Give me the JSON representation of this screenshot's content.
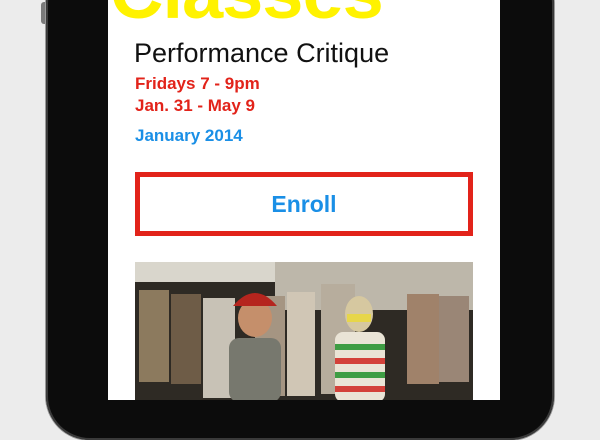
{
  "header": {
    "title": "Classes"
  },
  "class": {
    "name": "Performance Critique",
    "time": "Fridays 7 - 9pm",
    "dates": "Jan. 31 - May 9",
    "term": "January 2014"
  },
  "actions": {
    "enroll_label": "Enroll"
  },
  "colors": {
    "title_yellow": "#fff200",
    "accent_red": "#e2231a",
    "link_blue": "#1a8fe6"
  }
}
